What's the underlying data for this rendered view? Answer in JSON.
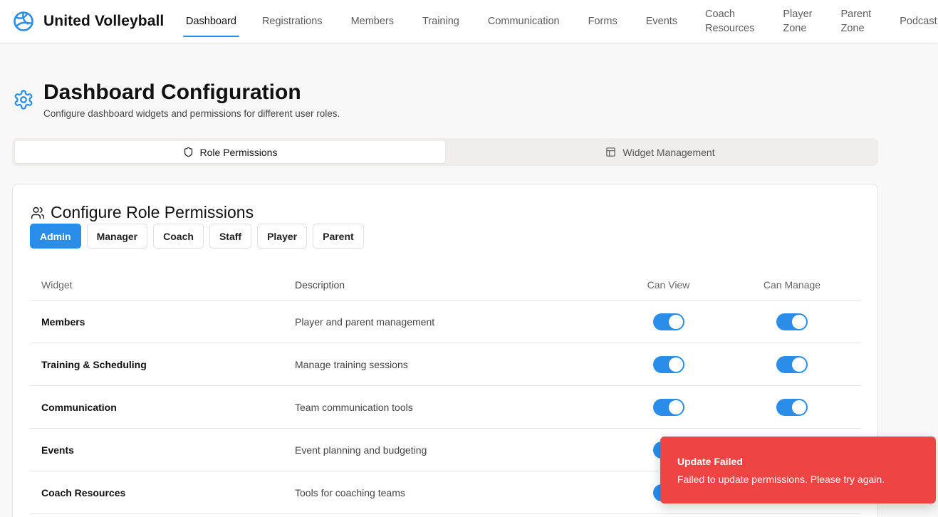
{
  "brand": {
    "name": "United Volleyball",
    "logo_icon": "volleyball-icon"
  },
  "nav": [
    {
      "label": "Dashboard",
      "active": true
    },
    {
      "label": "Registrations"
    },
    {
      "label": "Members"
    },
    {
      "label": "Training"
    },
    {
      "label": "Communication"
    },
    {
      "label": "Forms"
    },
    {
      "label": "Events"
    },
    {
      "label": "Coach\nResources"
    },
    {
      "label": "Player\nZone"
    },
    {
      "label": "Parent\nZone"
    },
    {
      "label": "Podcast"
    }
  ],
  "page": {
    "title": "Dashboard Configuration",
    "subtitle": "Configure dashboard widgets and permissions for different user roles.",
    "icon": "gear-icon"
  },
  "tabs": [
    {
      "label": "Role Permissions",
      "icon": "shield-icon",
      "active": true
    },
    {
      "label": "Widget Management",
      "icon": "layout-icon",
      "active": false
    }
  ],
  "card": {
    "title": "Configure Role Permissions",
    "icon": "users-icon",
    "roles": [
      {
        "label": "Admin",
        "active": true
      },
      {
        "label": "Manager"
      },
      {
        "label": "Coach"
      },
      {
        "label": "Staff"
      },
      {
        "label": "Player"
      },
      {
        "label": "Parent"
      }
    ],
    "columns": {
      "widget": "Widget",
      "description": "Description",
      "can_view": "Can View",
      "can_manage": "Can Manage"
    },
    "rows": [
      {
        "widget": "Members",
        "description": "Player and parent management",
        "can_view": true,
        "can_manage": true
      },
      {
        "widget": "Training & Scheduling",
        "description": "Manage training sessions",
        "can_view": true,
        "can_manage": true
      },
      {
        "widget": "Communication",
        "description": "Team communication tools",
        "can_view": true,
        "can_manage": true
      },
      {
        "widget": "Events",
        "description": "Event planning and budgeting",
        "can_view": true,
        "can_manage": true
      },
      {
        "widget": "Coach Resources",
        "description": "Tools for coaching teams",
        "can_view": true,
        "can_manage": true
      }
    ]
  },
  "toast": {
    "title": "Update Failed",
    "message": "Failed to update permissions. Please try again.",
    "color": "#ef4444"
  },
  "colors": {
    "accent": "#2a8de8",
    "error": "#ef4444"
  }
}
